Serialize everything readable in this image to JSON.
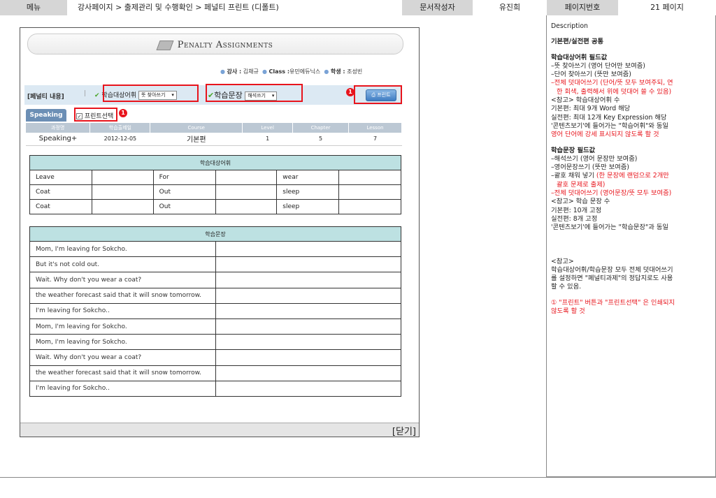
{
  "header": {
    "menu_label": "메뉴",
    "breadcrumb": "강사페이지 > 출제관리 및 수행확인 > 페널티 프린트 (디폴트)",
    "writer_label": "문서작성자",
    "writer": "유진희",
    "page_no_label": "페이지번호",
    "page_no": "21 페이지"
  },
  "screen": {
    "title": "Penalty Assignments",
    "info": {
      "teacher_label": "강사 :",
      "teacher": "김채규",
      "class_label": "Class :",
      "class": "유민에듀닉스",
      "student_label": "학생 :",
      "student": "조성빈"
    },
    "control": {
      "penalty_label": "[페널티 내용]",
      "vocab_label": "학습대상어휘",
      "vocab_select": "뜻 찾아쓰기",
      "sentence_label": "학습문장",
      "sentence_select": "해석쓰기",
      "print_button": "프린트",
      "badge": "1"
    },
    "tab_label": "Speaking",
    "print_select_label": "프린트선택",
    "print_select_badge": "1",
    "meta_headers": [
      "과정명",
      "학습출제일",
      "Course",
      "Level",
      "Chapter",
      "Lesson"
    ],
    "meta_values": [
      "Speaking+",
      "2012-12-05",
      "기본편",
      "1",
      "5",
      "7"
    ],
    "vocab_title": "학습대상어휘",
    "vocab_rows": [
      [
        "Leave",
        "",
        "For",
        "",
        "wear",
        ""
      ],
      [
        "Coat",
        "",
        "Out",
        "",
        "sleep",
        ""
      ],
      [
        "Coat",
        "",
        "Out",
        "",
        "sleep",
        ""
      ]
    ],
    "sentence_title": "학습문장",
    "sentences": [
      "Mom, I'm leaving for Sokcho.",
      "But it's not cold out.",
      "Wait. Why don't you wear a coat?",
      "the weather forecast said that it will snow tomorrow.",
      "I'm leaving for Sokcho..",
      "Mom, I'm leaving for Sokcho.",
      "Mom, I'm leaving for Sokcho.",
      "Wait. Why don't you wear a coat?",
      "the weather forecast said that it will snow tomorrow.",
      "I'm leaving for Sokcho.."
    ],
    "close_button": "[닫기]"
  },
  "description": {
    "heading": "Description",
    "common": "기본편/실전편 공통",
    "vocab_title": "학습대상어휘 필드값",
    "vocab_1": "–뜻 찾아쓰기 (영어 단어만 보여줌)",
    "vocab_2": "–단어 찾아쓰기 (뜻만 보여줌)",
    "vocab_3": "–전체 덧대어쓰기 (단어/뜻 모두 보여주되, 연",
    "vocab_3b": "한 회색, 출력해서 위에 덧대어 쓸 수 있음)",
    "vocab_ref": "<참고> 학습대상어휘 수",
    "vocab_basic": "기본편: 최대 9개 Word 해당",
    "vocab_adv": "실전편: 최대 12개 Key Expression 해당",
    "vocab_same": "'콘텐츠보기'에 들어가는 \"학습어휘\"와 동일",
    "vocab_warn": "영어 단어에 강세 표시되지 않도록 할 것",
    "sent_title": "학습문장 필드값",
    "sent_1": "–해석쓰기 (영어 문장만 보여줌)",
    "sent_2": "–영어문장쓰기 (뜻만 보여줌)",
    "sent_3": "–괄호 채워 넣기",
    "sent_3r": "(한 문장에 랜덤으로 2개만",
    "sent_3b": "괄호 문제로 출제)",
    "sent_4": "–전체 덧대어쓰기 (영어문장/뜻 모두 보여줌)",
    "sent_ref": "<참고> 학습 문장 수",
    "sent_basic": "기본편: 10개 고정",
    "sent_adv": "실전편: 8개 고정",
    "sent_same": "'콘텐츠보기'에 들어가는 \"학습문장\"과 동일",
    "ref2_title": "<참고>",
    "ref2_1": "학습대상어휘/학습문장 모두 전체 덧대어쓰기",
    "ref2_2": "를 설정하면 \"페널티과제\"의 정답지로도 사용",
    "ref2_3": "할 수 있음.",
    "note_1": "① \"프린트\" 버튼과 \"프린트선택\" 은 인쇄되지",
    "note_2": "않도록 할 것"
  }
}
